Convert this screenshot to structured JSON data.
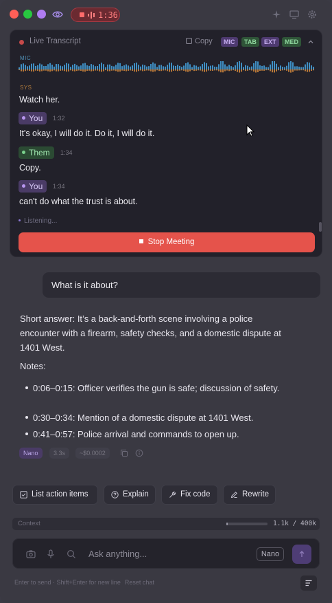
{
  "titlebar": {
    "recording_time": "1:36"
  },
  "transcript": {
    "title": "Live Transcript",
    "copy_label": "Copy",
    "tags": [
      "MIC",
      "TAB",
      "EXT",
      "MED"
    ],
    "mic_label": "MIC",
    "sys_label": "SYS",
    "lines": [
      {
        "text": "Watch her."
      },
      {
        "speaker": "You",
        "time": "1:32",
        "text": "It's okay, I will do it. Do it, I will do it."
      },
      {
        "speaker": "Them",
        "time": "1:34",
        "text": "Copy."
      },
      {
        "speaker": "You",
        "time": "1:34",
        "text": "can't do what the trust is about."
      }
    ],
    "listening": "Listening...",
    "stop_label": "Stop Meeting"
  },
  "chat": {
    "user_message": "What is it about?",
    "answer": "Short answer: It’s a back-and-forth scene involving a police encounter with a firearm, safety checks, and a domestic dispute at 1401 West.",
    "notes_heading": "Notes:",
    "notes": [
      "0:06–0:15: Officer verifies the gun is safe; discussion of safety.",
      "0:30–0:34: Mention of a domestic dispute at 1401 West.",
      "0:41–0:57: Police arrival and commands to open up."
    ],
    "meta": {
      "model": "Nano",
      "duration": "3.3s",
      "cost": "~$0.0002"
    }
  },
  "quick_actions": [
    "List action items",
    "Explain",
    "Fix code",
    "Rewrite"
  ],
  "context": {
    "label": "Context",
    "used_fraction": 0.03,
    "count": "1.1k / 400k"
  },
  "composer": {
    "placeholder": "Ask anything...",
    "model_button": "Nano",
    "hint": "Enter to send · Shift+Enter for new line",
    "reset_label": "Reset chat"
  },
  "colors": {
    "accent": "#e5534b",
    "you": "#b896f0",
    "them": "#7ad18d",
    "panel": "#22212a"
  }
}
